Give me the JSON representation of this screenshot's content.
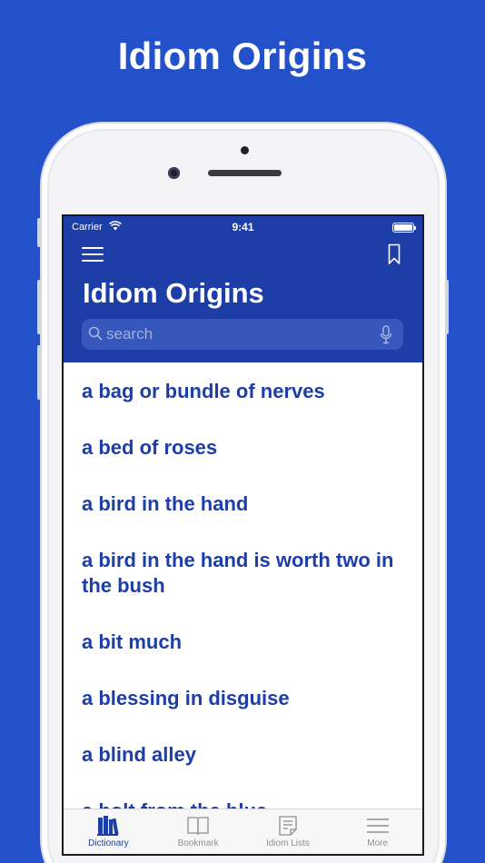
{
  "promo": {
    "headline": "Idiom Origins"
  },
  "status_bar": {
    "carrier": "Carrier",
    "time": "9:41"
  },
  "header": {
    "title": "Idiom Origins"
  },
  "search": {
    "placeholder": "search"
  },
  "idioms": [
    "a bag or bundle of nerves",
    "a bed of roses",
    "a bird in the hand",
    "a bird in the hand is worth two in the bush",
    "a bit much",
    "a blessing in disguise",
    "a blind alley",
    "a bolt from the blue"
  ],
  "tabs": [
    {
      "label": "Dictionary",
      "icon": "books-icon",
      "active": true
    },
    {
      "label": "Bookmark",
      "icon": "open-book-icon",
      "active": false
    },
    {
      "label": "Idiom Lists",
      "icon": "document-icon",
      "active": false
    },
    {
      "label": "More",
      "icon": "hamburger-icon",
      "active": false
    }
  ],
  "colors": {
    "background": "#2251c9",
    "nav": "#1d3ea6",
    "accent": "#1d3ea6"
  }
}
